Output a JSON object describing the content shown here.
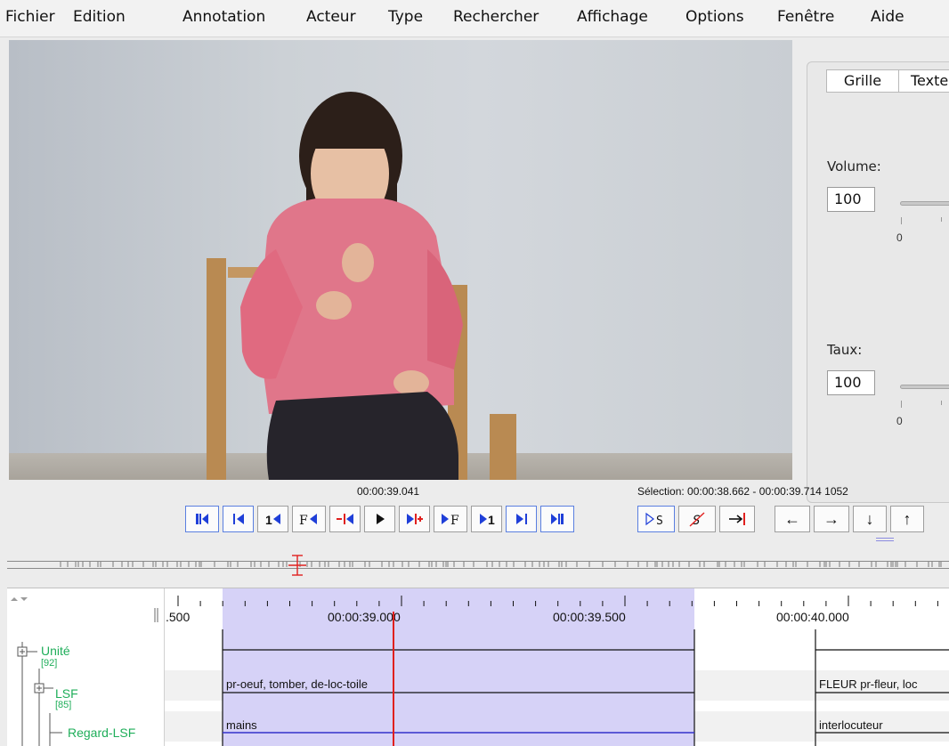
{
  "menu": [
    "Fichier",
    "Edition",
    "Annotation",
    "Acteur",
    "Type",
    "Rechercher",
    "Affichage",
    "Options",
    "Fenêtre",
    "Aide"
  ],
  "sidepanel": {
    "tabs": [
      "Grille",
      "Texte"
    ],
    "volume_label": "Volume:",
    "volume_value": "100",
    "volume_tick": "0",
    "rate_label": "Taux:",
    "rate_value": "100",
    "rate_tick": "0"
  },
  "transport": {
    "current_time": "00:00:39.041",
    "selection": "Sélection: 00:00:38.662 - 00:00:39.714  1052",
    "buttons": [
      "|◀◀",
      "|◀",
      "1◀",
      "F◀",
      "-|◀",
      "▶",
      "▶|+",
      "▶F",
      "▶1",
      "▶|",
      "▶▶|"
    ],
    "sel_buttons": [
      "▷S",
      "S",
      "→|"
    ],
    "nav_buttons": [
      "←",
      "→",
      "↓",
      "↑"
    ]
  },
  "ruler": {
    "labels": [
      ".500",
      "00:00:39.000",
      "00:00:39.500",
      "00:00:40.000"
    ]
  },
  "tiers": [
    {
      "name": "Unité",
      "count": "[92]"
    },
    {
      "name": "LSF",
      "count": "[85]"
    },
    {
      "name": "Regard-LSF",
      "count": ""
    }
  ],
  "annotations": {
    "lsf_1": "pr-oeuf, tomber, de-loc-toile",
    "lsf_2": "FLEUR pr-fleur, loc",
    "regard_1": "mains",
    "regard_2": "interlocuteur"
  },
  "colors": {
    "selection": "#d6d2f7",
    "crosshair": "#e0201e",
    "tier_text": "#1fae5a",
    "accent": "#1f3fd8"
  }
}
